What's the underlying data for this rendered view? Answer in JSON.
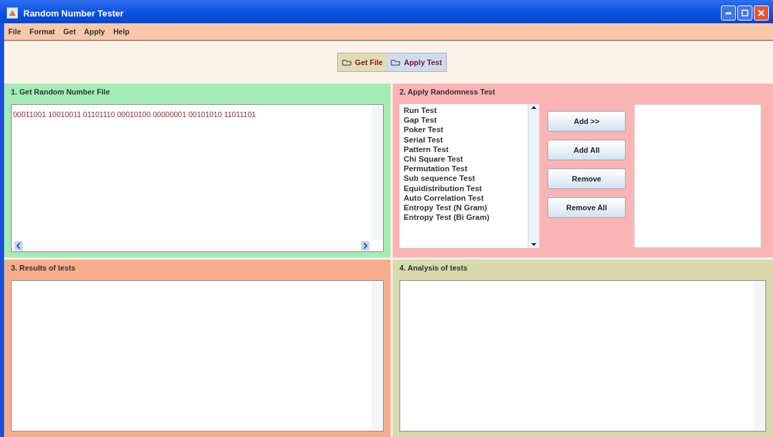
{
  "window": {
    "title": "Random Number Tester"
  },
  "menu": [
    "File",
    "Format",
    "Get",
    "Apply",
    "Help"
  ],
  "toolbar": [
    {
      "label": "Get File",
      "color": "#e2dcb4"
    },
    {
      "label": "Apply Test",
      "color": "#cfdcef"
    }
  ],
  "panels": [
    {
      "title": "1. Get Random Number File",
      "kind": "data",
      "text": "00011001 10010011 01101110 00010100 00000001 00101010 11011101"
    },
    {
      "title": "2. Apply Randomness Test",
      "kind": "tests",
      "available": [
        "Run Test",
        "Gap Test",
        "Poker Test",
        "Serial Test",
        "Pattern Test",
        "Chi Square Test",
        "Permutation Test",
        "Sub sequence Test",
        "Equidistribution Test",
        "Auto Correlation Test",
        "Entropy Test (N Gram)",
        "Entropy Test (Bi Gram)"
      ],
      "buttons": [
        "Add >>",
        "Add All",
        "Remove",
        "Remove All"
      ]
    },
    {
      "title": "3. Results of tests",
      "kind": "output"
    },
    {
      "title": "4. Analysis of tests",
      "kind": "output"
    }
  ]
}
